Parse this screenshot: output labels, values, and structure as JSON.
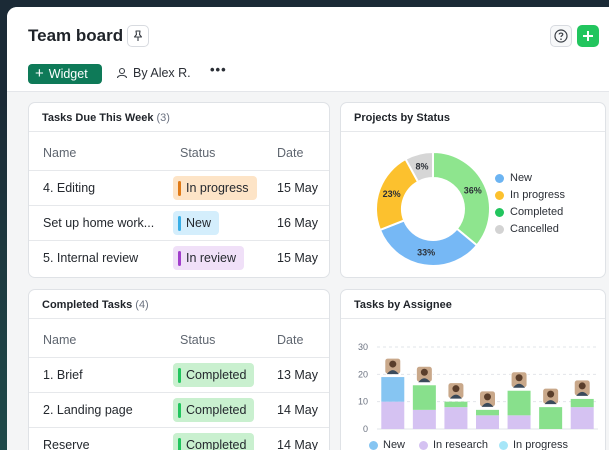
{
  "header": {
    "title": "Team board",
    "widget_label": "Widget",
    "by_user": "By Alex R.",
    "more": "•••"
  },
  "tasks_due": {
    "title": "Tasks Due This Week",
    "count": "(3)",
    "columns": [
      "Name",
      "Status",
      "Date"
    ],
    "rows": [
      {
        "name": "4. Editing",
        "status": "In progress",
        "date": "15 May",
        "color": "#fde4c7",
        "bar": "#e07a16"
      },
      {
        "name": "Set up home work...",
        "status": "New",
        "date": "16 May",
        "color": "#d4eefc",
        "bar": "#38aee6"
      },
      {
        "name": "5. Internal review",
        "status": "In review",
        "date": "15 May",
        "color": "#f0e0f8",
        "bar": "#a13ecb"
      }
    ]
  },
  "completed": {
    "title": "Completed Tasks",
    "count": "(4)",
    "columns": [
      "Name",
      "Status",
      "Date"
    ],
    "rows": [
      {
        "name": "1. Brief",
        "status": "Completed",
        "date": "13 May",
        "color": "#c9f0cf",
        "bar": "#22c55e"
      },
      {
        "name": "2. Landing page",
        "status": "Completed",
        "date": "14 May",
        "color": "#c9f0cf",
        "bar": "#22c55e"
      },
      {
        "name": "Reserve",
        "status": "Completed",
        "date": "14 May",
        "color": "#c9f0cf",
        "bar": "#22c55e"
      }
    ]
  },
  "projects_status": {
    "title": "Projects by Status",
    "legend": [
      {
        "label": "New",
        "color": "#6cb4f2"
      },
      {
        "label": "In progress",
        "color": "#fcc12e"
      },
      {
        "label": "Completed",
        "color": "#22c55e"
      },
      {
        "label": "Cancelled",
        "color": "#d3d3d3"
      }
    ]
  },
  "tasks_assignee": {
    "title": "Tasks by Assignee",
    "legend": [
      {
        "label": "New",
        "color": "#86c5f2"
      },
      {
        "label": "In research",
        "color": "#d5c2f2"
      },
      {
        "label": "In progress",
        "color": "#a6e6f8"
      }
    ]
  },
  "chart_data": [
    {
      "type": "pie",
      "title": "Projects by Status",
      "categories": [
        "Completed",
        "New",
        "In progress",
        "Cancelled"
      ],
      "values": [
        36,
        33,
        23,
        8
      ],
      "labels": [
        "36%",
        "33%",
        "23%",
        "8%"
      ],
      "colors": [
        "#8ee58e",
        "#76b8f5",
        "#fcc12e",
        "#d6d6d6"
      ],
      "legend": "right"
    },
    {
      "type": "bar",
      "title": "Tasks by Assignee",
      "yticks": [
        0,
        10,
        20,
        30
      ],
      "ylim": [
        0,
        30
      ],
      "categories": [
        "",
        "",
        "",
        "",
        "",
        "",
        ""
      ],
      "series": [
        {
          "name": "In research",
          "values": [
            10,
            7,
            8,
            5,
            5,
            0,
            8
          ],
          "color": "#d5c2f2"
        },
        {
          "name": "",
          "values": [
            0,
            0,
            0,
            0,
            0,
            0,
            0
          ],
          "color": "#fde07a"
        },
        {
          "name": "New",
          "values": [
            9,
            0,
            0,
            0,
            0,
            0,
            0
          ],
          "color": "#86c5f2"
        },
        {
          "name": "",
          "values": [
            0,
            9,
            2,
            2,
            9,
            8,
            3
          ],
          "color": "#88e08c"
        }
      ],
      "legend": "bottom"
    }
  ]
}
